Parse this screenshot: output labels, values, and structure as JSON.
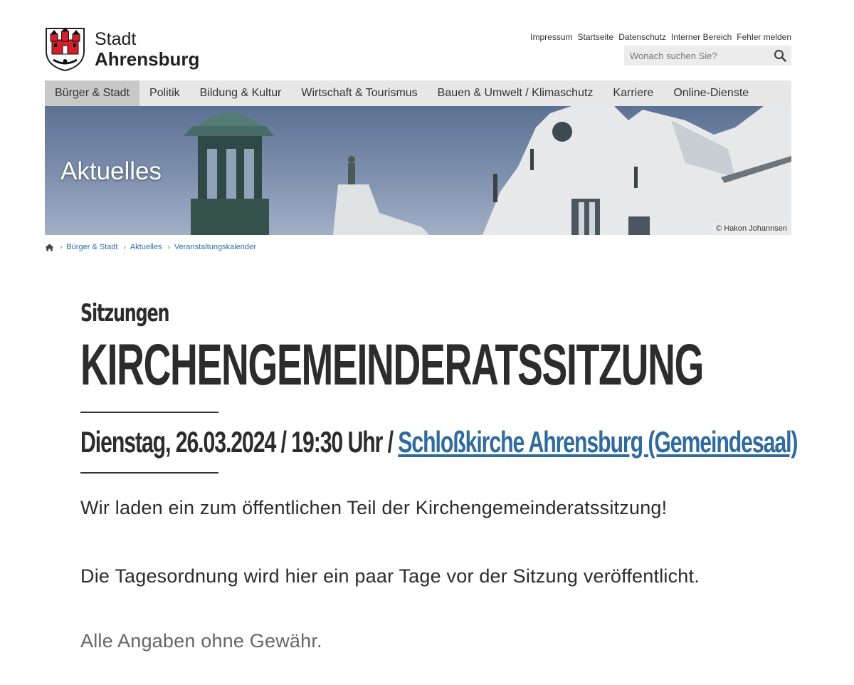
{
  "logo": {
    "line1": "Stadt",
    "line2": "Ahrensburg",
    "crest_colors": {
      "red": "#d21f2b",
      "black": "#111111"
    }
  },
  "service_links": [
    "Impressum",
    "Startseite",
    "Datenschutz",
    "Interner Bereich",
    "Fehler melden"
  ],
  "search": {
    "placeholder": "Wonach suchen Sie?",
    "icon": "search-icon"
  },
  "nav": {
    "items": [
      "Bürger & Stadt",
      "Politik",
      "Bildung & Kultur",
      "Wirtschaft & Tourismus",
      "Bauen & Umwelt / Klimaschutz",
      "Karriere",
      "Online-Dienste"
    ],
    "active_index": 0
  },
  "hero": {
    "title": "Aktuelles",
    "credit": "© Hakon Johannsen"
  },
  "breadcrumb": {
    "home_icon": "home-icon",
    "items": [
      "Bürger & Stadt",
      "Aktuelles",
      "Veranstaltungskalender"
    ]
  },
  "event": {
    "category": "Sitzungen",
    "title": "KIRCHENGEMEINDERATSSITZUNG",
    "date_time": "Dienstag, 26.03.2024 / 19:30 Uhr / ",
    "location": "Schloßkirche Ahrensburg (Gemeindesaal)",
    "paragraphs": [
      "Wir laden ein zum öffentlichen Teil der Kirchengemeinderatssitzung!",
      "Die Tagesordnung wird hier ein paar Tage vor der Sitzung veröffentlicht.",
      "Alle Angaben ohne Gewähr."
    ]
  },
  "colors": {
    "link": "#2f6b9e",
    "nav_bg": "#e7e7e7",
    "nav_active": "#c8c8c8",
    "text": "#2c2c2c"
  }
}
